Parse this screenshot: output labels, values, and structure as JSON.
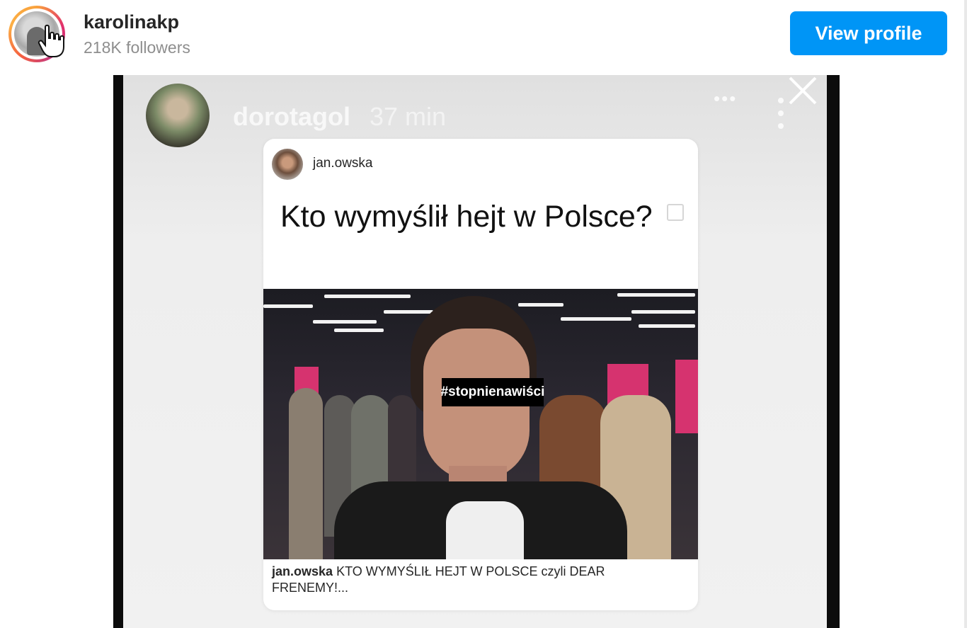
{
  "header": {
    "username": "karolinakp",
    "followers": "218K followers",
    "view_profile_label": "View profile"
  },
  "story": {
    "username": "dorotagol",
    "time": "37 min",
    "more_label": "•••",
    "shared_post": {
      "username": "jan.owska",
      "headline": "Kto wymyślił hejt w Polsce?",
      "censor_tag": "#stopnienawiści",
      "caption_user": "jan.owska",
      "caption_text": "KTO WYMYŚLIŁ HEJT W POLSCE czyli DEAR FRENEMY!..."
    }
  },
  "colors": {
    "accent": "#0095f6",
    "text_primary": "#262626",
    "text_secondary": "#8e8e8e",
    "highlight_pink": "#d6336f"
  },
  "icons": {
    "cursor": "hand-pointer-icon",
    "close": "close-icon",
    "more_horizontal": "more-horizontal-icon",
    "more_vertical": "more-vertical-icon"
  }
}
